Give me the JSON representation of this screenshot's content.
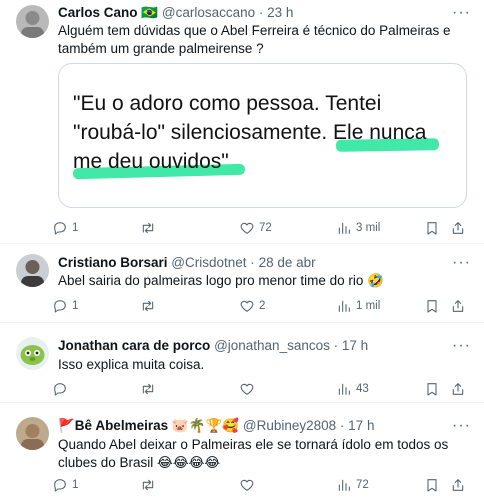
{
  "tweets": [
    {
      "name": "Carlos Cano",
      "flag": "🇧🇷",
      "handle": "@carlosaccano",
      "dot": "·",
      "time": "23 h",
      "text": "Alguém tem dúvidas que o Abel Ferreira é técnico do Palmeiras e também um grande palmeirense ?",
      "quote_lines": [
        "\"Eu o adoro como pessoa. Tentei",
        "\"roubá-lo\" silenciosamente. Ele nunca",
        "me deu ouvidos\""
      ],
      "replies": "1",
      "retweets": "",
      "likes": "72",
      "views": "3 mil"
    },
    {
      "name": "Cristiano Borsari",
      "handle": "@Crisdotnet",
      "dot": "·",
      "time": "28 de abr",
      "text": "Abel sairia do palmeiras logo pro menor time do rio 🤣",
      "replies": "1",
      "retweets": "",
      "likes": "2",
      "views": "1 mil"
    },
    {
      "name": "Jonathan cara de porco",
      "handle": "@jonathan_sancos",
      "dot": "·",
      "time": "17 h",
      "text": "Isso explica muita coisa.",
      "replies": "",
      "retweets": "",
      "likes": "",
      "views": "43"
    },
    {
      "name": "🚩Bê Abelmeiras 🐷🌴🏆🥰",
      "handle": "@Rubiney2808",
      "dot": "·",
      "time": "17 h",
      "text": "Quando Abel deixar o Palmeiras ele se tornará ídolo em todos os clubes do Brasil 😂😂😂😂",
      "replies": "1",
      "retweets": "",
      "likes": "",
      "views": "72"
    }
  ],
  "more_label": "···",
  "colors": {
    "accent_highlight": "#2ee59d",
    "text": "#0f1419",
    "muted": "#536471",
    "border": "#eff3f4"
  },
  "icons": [
    "reply-icon",
    "retweet-icon",
    "like-icon",
    "views-icon",
    "bookmark-icon",
    "share-icon",
    "more-icon"
  ]
}
